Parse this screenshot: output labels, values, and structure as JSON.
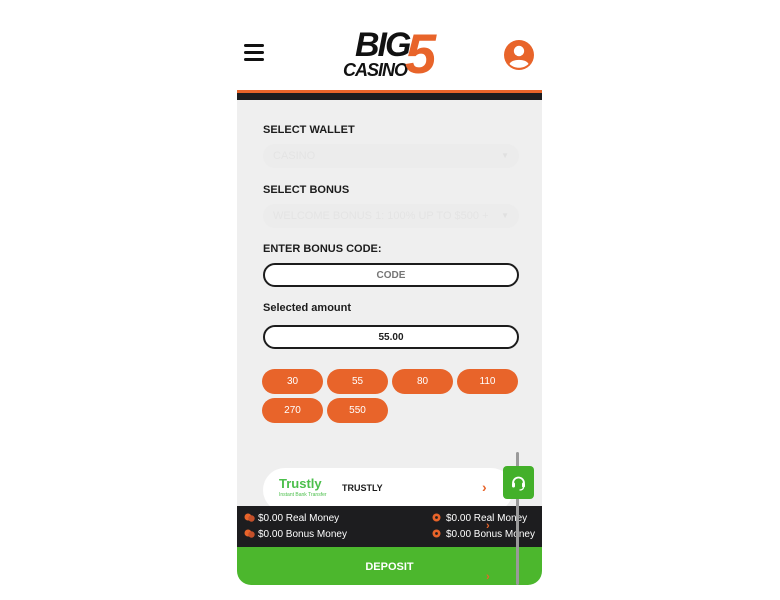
{
  "header": {
    "logo_big": "BIG",
    "logo_casino": "CASINO",
    "logo_five": "5",
    "menu_icon": "hamburger-menu-icon",
    "profile_icon": "user-profile-icon"
  },
  "form": {
    "wallet_label": "SELECT WALLET",
    "wallet_value": "CASINO",
    "bonus_label": "SELECT BONUS",
    "bonus_value": "WELCOME BONUS 1: 100% UP TO $500 +",
    "code_label": "ENTER BONUS CODE:",
    "code_value": "CODE",
    "amount_label": "Selected amount",
    "amount_value": "55.00",
    "amounts": [
      "30",
      "55",
      "80",
      "110",
      "270",
      "550"
    ]
  },
  "payment_method": {
    "logo_text": "Trustly",
    "logo_subtext": "Instant Bank Transfer",
    "name": "TRUSTLY"
  },
  "balances": {
    "left_real": "$0.00 Real Money",
    "left_bonus": "$0.00 Bonus Money",
    "right_real": "$0.00 Real Money",
    "right_bonus": "$0.00 Bonus Money"
  },
  "deposit_label": "DEPOSIT",
  "colors": {
    "accent": "#e8642a",
    "dark": "#1d1d1f",
    "green": "#4cb72d",
    "trustly_green": "#4bbf4b",
    "panel": "#efefef"
  }
}
